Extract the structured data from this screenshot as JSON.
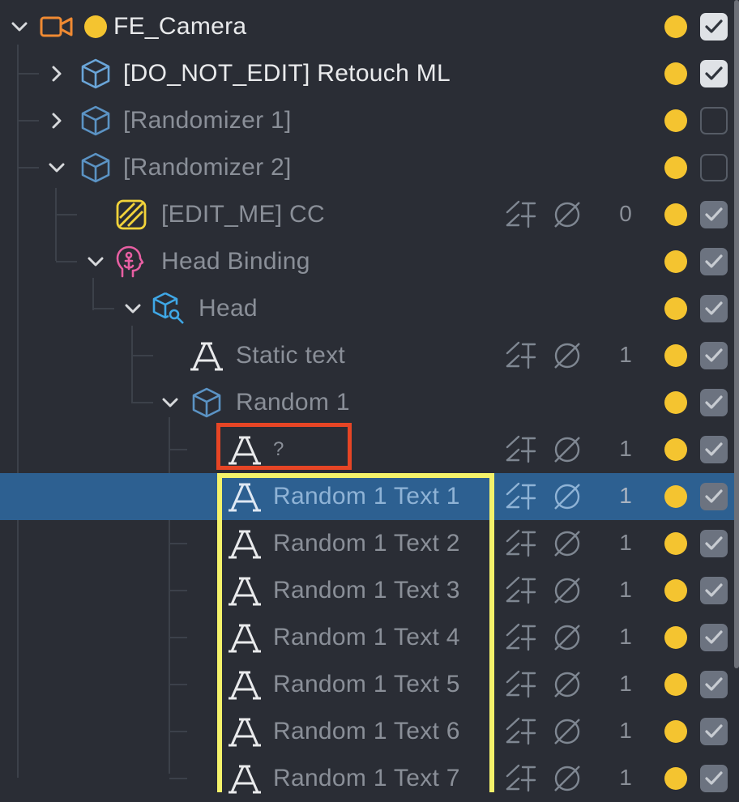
{
  "rows": [
    {
      "label": "FE_Camera",
      "icon": "camera-icon",
      "chevron": "down",
      "dim": false,
      "text_row": false,
      "checkbox": "checked-bright",
      "name": "fe-camera"
    },
    {
      "label": "[DO_NOT_EDIT] Retouch ML",
      "icon": "group-cube-icon",
      "chevron": "right",
      "dim": false,
      "text_row": false,
      "checkbox": "checked-bright",
      "name": "retouch-ml"
    },
    {
      "label": "[Randomizer 1]",
      "icon": "group-cube-icon",
      "chevron": "right",
      "dim": true,
      "text_row": false,
      "checkbox": "unchecked",
      "name": "randomizer-1"
    },
    {
      "label": "[Randomizer 2]",
      "icon": "group-cube-icon",
      "chevron": "down",
      "dim": true,
      "text_row": false,
      "checkbox": "unchecked",
      "name": "randomizer-2"
    },
    {
      "label": "[EDIT_ME] CC",
      "icon": "color-correction-icon",
      "chevron": "",
      "dim": true,
      "text_row": true,
      "count": "0",
      "checkbox": "checked-dim",
      "name": "edit-me-cc"
    },
    {
      "label": "Head Binding",
      "icon": "head-binding-icon",
      "chevron": "down",
      "dim": true,
      "text_row": false,
      "checkbox": "checked-dim",
      "name": "head-binding"
    },
    {
      "label": "Head",
      "icon": "head-object-icon",
      "chevron": "down",
      "dim": true,
      "text_row": false,
      "checkbox": "checked-dim",
      "name": "head"
    },
    {
      "label": "Static text",
      "icon": "text-icon",
      "chevron": "",
      "dim": true,
      "text_row": true,
      "count": "1",
      "checkbox": "checked-dim",
      "name": "static-text"
    },
    {
      "label": "Random 1",
      "icon": "group-cube-icon",
      "chevron": "down",
      "dim": true,
      "text_row": false,
      "checkbox": "checked-dim",
      "name": "random-1"
    },
    {
      "label": "?",
      "icon": "text-icon",
      "chevron": "",
      "dim": true,
      "text_row": true,
      "count": "1",
      "checkbox": "checked-dim",
      "name": "unnamed-text"
    },
    {
      "label": "Random 1 Text 1",
      "icon": "text-icon",
      "chevron": "",
      "dim": true,
      "text_row": true,
      "count": "1",
      "checkbox": "checked-dim",
      "selected": true,
      "name": "random-1-text-1"
    },
    {
      "label": "Random 1 Text 2",
      "icon": "text-icon",
      "chevron": "",
      "dim": true,
      "text_row": true,
      "count": "1",
      "checkbox": "checked-dim",
      "name": "random-1-text-2"
    },
    {
      "label": "Random 1 Text 3",
      "icon": "text-icon",
      "chevron": "",
      "dim": true,
      "text_row": true,
      "count": "1",
      "checkbox": "checked-dim",
      "name": "random-1-text-3"
    },
    {
      "label": "Random 1 Text 4",
      "icon": "text-icon",
      "chevron": "",
      "dim": true,
      "text_row": true,
      "count": "1",
      "checkbox": "checked-dim",
      "name": "random-1-text-4"
    },
    {
      "label": "Random 1 Text 5",
      "icon": "text-icon",
      "chevron": "",
      "dim": true,
      "text_row": true,
      "count": "1",
      "checkbox": "checked-dim",
      "name": "random-1-text-5"
    },
    {
      "label": "Random 1 Text 6",
      "icon": "text-icon",
      "chevron": "",
      "dim": true,
      "text_row": true,
      "count": "1",
      "checkbox": "checked-dim",
      "name": "random-1-text-6"
    },
    {
      "label": "Random 1 Text 7",
      "icon": "text-icon",
      "chevron": "",
      "dim": true,
      "text_row": true,
      "count": "1",
      "checkbox": "checked-dim",
      "name": "random-1-text-7"
    }
  ],
  "colors": {
    "background": "#2a2d35",
    "selection": "#2d6091",
    "visibility_dot": "#f4c430",
    "annotation_red": "#e64525",
    "annotation_yellow": "#f4f26a"
  }
}
